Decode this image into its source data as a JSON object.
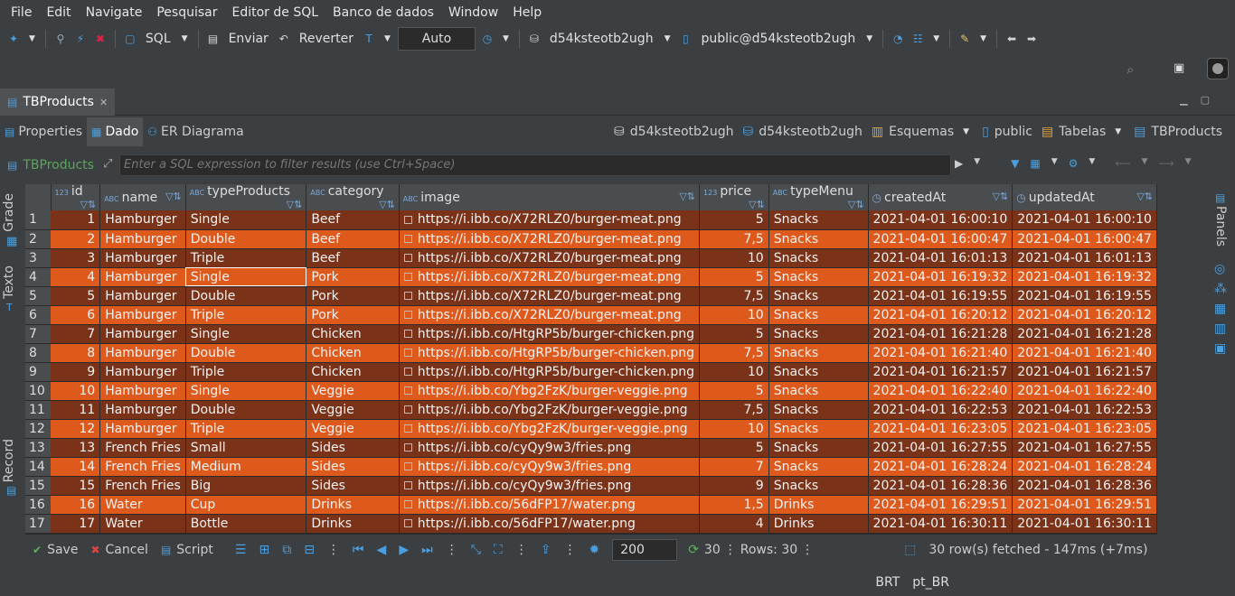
{
  "menu": [
    "File",
    "Edit",
    "Navigate",
    "Pesquisar",
    "Editor de SQL",
    "Banco de dados",
    "Window",
    "Help"
  ],
  "toolbar": {
    "sql_label": "SQL",
    "enviar_label": "Enviar",
    "reverter_label": "Reverter",
    "auto_label": "Auto",
    "connection": "d54ksteotb2ugh",
    "schema": "public@d54ksteotb2ugh"
  },
  "editor_tab": {
    "title": "TBProducts"
  },
  "subtabs": [
    {
      "label": "Properties"
    },
    {
      "label": "Dado"
    },
    {
      "label": "ER Diagrama"
    }
  ],
  "breadcrumbs": [
    "d54ksteotb2ugh",
    "d54ksteotb2ugh",
    "Esquemas",
    "public",
    "Tabelas",
    "TBProducts"
  ],
  "filter": {
    "table_label": "TBProducts",
    "placeholder": "Enter a SQL expression to filter results (use Ctrl+Space)"
  },
  "left_tabs": [
    "Grade",
    "Texto",
    "Record"
  ],
  "right_tabs": [
    "Panels"
  ],
  "grid": {
    "columns": [
      {
        "name": "id",
        "type": "123"
      },
      {
        "name": "name",
        "type": "ABC"
      },
      {
        "name": "typeProducts",
        "type": "ABC"
      },
      {
        "name": "category",
        "type": "ABC"
      },
      {
        "name": "image",
        "type": "ABC"
      },
      {
        "name": "price",
        "type": "123"
      },
      {
        "name": "typeMenu",
        "type": "ABC"
      },
      {
        "name": "createdAt",
        "type": "clock"
      },
      {
        "name": "updatedAt",
        "type": "clock"
      }
    ],
    "rows": [
      [
        "1",
        "1",
        "Hamburger",
        "Single",
        "Beef",
        "https://i.ibb.co/X72RLZ0/burger-meat.png",
        "5",
        "Snacks",
        "2021-04-01 16:00:10",
        "2021-04-01 16:00:10"
      ],
      [
        "2",
        "2",
        "Hamburger",
        "Double",
        "Beef",
        "https://i.ibb.co/X72RLZ0/burger-meat.png",
        "7,5",
        "Snacks",
        "2021-04-01 16:00:47",
        "2021-04-01 16:00:47"
      ],
      [
        "3",
        "3",
        "Hamburger",
        "Triple",
        "Beef",
        "https://i.ibb.co/X72RLZ0/burger-meat.png",
        "10",
        "Snacks",
        "2021-04-01 16:01:13",
        "2021-04-01 16:01:13"
      ],
      [
        "4",
        "4",
        "Hamburger",
        "Single",
        "Pork",
        "https://i.ibb.co/X72RLZ0/burger-meat.png",
        "5",
        "Snacks",
        "2021-04-01 16:19:32",
        "2021-04-01 16:19:32"
      ],
      [
        "5",
        "5",
        "Hamburger",
        "Double",
        "Pork",
        "https://i.ibb.co/X72RLZ0/burger-meat.png",
        "7,5",
        "Snacks",
        "2021-04-01 16:19:55",
        "2021-04-01 16:19:55"
      ],
      [
        "6",
        "6",
        "Hamburger",
        "Triple",
        "Pork",
        "https://i.ibb.co/X72RLZ0/burger-meat.png",
        "10",
        "Snacks",
        "2021-04-01 16:20:12",
        "2021-04-01 16:20:12"
      ],
      [
        "7",
        "7",
        "Hamburger",
        "Single",
        "Chicken",
        "https://i.ibb.co/HtgRP5b/burger-chicken.png",
        "5",
        "Snacks",
        "2021-04-01 16:21:28",
        "2021-04-01 16:21:28"
      ],
      [
        "8",
        "8",
        "Hamburger",
        "Double",
        "Chicken",
        "https://i.ibb.co/HtgRP5b/burger-chicken.png",
        "7,5",
        "Snacks",
        "2021-04-01 16:21:40",
        "2021-04-01 16:21:40"
      ],
      [
        "9",
        "9",
        "Hamburger",
        "Triple",
        "Chicken",
        "https://i.ibb.co/HtgRP5b/burger-chicken.png",
        "10",
        "Snacks",
        "2021-04-01 16:21:57",
        "2021-04-01 16:21:57"
      ],
      [
        "10",
        "10",
        "Hamburger",
        "Single",
        "Veggie",
        "https://i.ibb.co/Ybg2FzK/burger-veggie.png",
        "5",
        "Snacks",
        "2021-04-01 16:22:40",
        "2021-04-01 16:22:40"
      ],
      [
        "11",
        "11",
        "Hamburger",
        "Double",
        "Veggie",
        "https://i.ibb.co/Ybg2FzK/burger-veggie.png",
        "7,5",
        "Snacks",
        "2021-04-01 16:22:53",
        "2021-04-01 16:22:53"
      ],
      [
        "12",
        "12",
        "Hamburger",
        "Triple",
        "Veggie",
        "https://i.ibb.co/Ybg2FzK/burger-veggie.png",
        "10",
        "Snacks",
        "2021-04-01 16:23:05",
        "2021-04-01 16:23:05"
      ],
      [
        "13",
        "13",
        "French Fries",
        "Small",
        "Sides",
        "https://i.ibb.co/cyQy9w3/fries.png",
        "5",
        "Snacks",
        "2021-04-01 16:27:55",
        "2021-04-01 16:27:55"
      ],
      [
        "14",
        "14",
        "French Fries",
        "Medium",
        "Sides",
        "https://i.ibb.co/cyQy9w3/fries.png",
        "7",
        "Snacks",
        "2021-04-01 16:28:24",
        "2021-04-01 16:28:24"
      ],
      [
        "15",
        "15",
        "French Fries",
        "Big",
        "Sides",
        "https://i.ibb.co/cyQy9w3/fries.png",
        "9",
        "Snacks",
        "2021-04-01 16:28:36",
        "2021-04-01 16:28:36"
      ],
      [
        "16",
        "16",
        "Water",
        "Cup",
        "Drinks",
        "https://i.ibb.co/56dFP17/water.png",
        "1,5",
        "Drinks",
        "2021-04-01 16:29:51",
        "2021-04-01 16:29:51"
      ],
      [
        "17",
        "17",
        "Water",
        "Bottle",
        "Drinks",
        "https://i.ibb.co/56dFP17/water.png",
        "4",
        "Drinks",
        "2021-04-01 16:30:11",
        "2021-04-01 16:30:11"
      ]
    ]
  },
  "status": {
    "save_label": "Save",
    "cancel_label": "Cancel",
    "script_label": "Script",
    "fetch_size": "200",
    "fetch_count": "30",
    "rows_label": "Rows: 30",
    "fetched_msg": "30 row(s) fetched - 147ms (+7ms)"
  },
  "bottom": {
    "keyboard": "BRT",
    "locale": "pt_BR"
  },
  "colors": {
    "row_odd": "#7a3218",
    "row_even": "#dd5a1c",
    "header_bg": "#4a4d50",
    "panel_bg": "#3c3f41",
    "accent_blue": "#4a9fe0"
  }
}
